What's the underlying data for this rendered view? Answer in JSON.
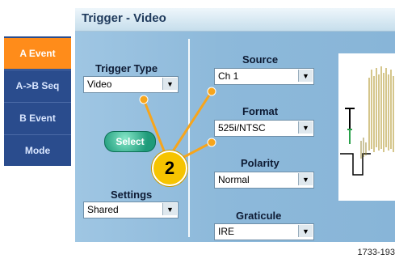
{
  "title": "Trigger - Video",
  "tabs": [
    {
      "label": "A Event",
      "active": true
    },
    {
      "label": "A->B Seq",
      "active": false
    },
    {
      "label": "B Event",
      "active": false
    },
    {
      "label": "Mode",
      "active": false
    }
  ],
  "trigger_type": {
    "label": "Trigger Type",
    "value": "Video"
  },
  "select_button": "Select",
  "settings": {
    "label": "Settings",
    "value": "Shared"
  },
  "source": {
    "label": "Source",
    "value": "Ch 1"
  },
  "format": {
    "label": "Format",
    "value": "525i/NTSC"
  },
  "polarity": {
    "label": "Polarity",
    "value": "Normal"
  },
  "graticule": {
    "label": "Graticule",
    "value": "IRE"
  },
  "callout": "2",
  "caption": "1733-193",
  "colors": {
    "active_tab": "#ff8c1a",
    "nav": "#2a4c8d",
    "panel": "#8db9da",
    "callout": "#f6c400",
    "lines": "#f7a51c"
  }
}
